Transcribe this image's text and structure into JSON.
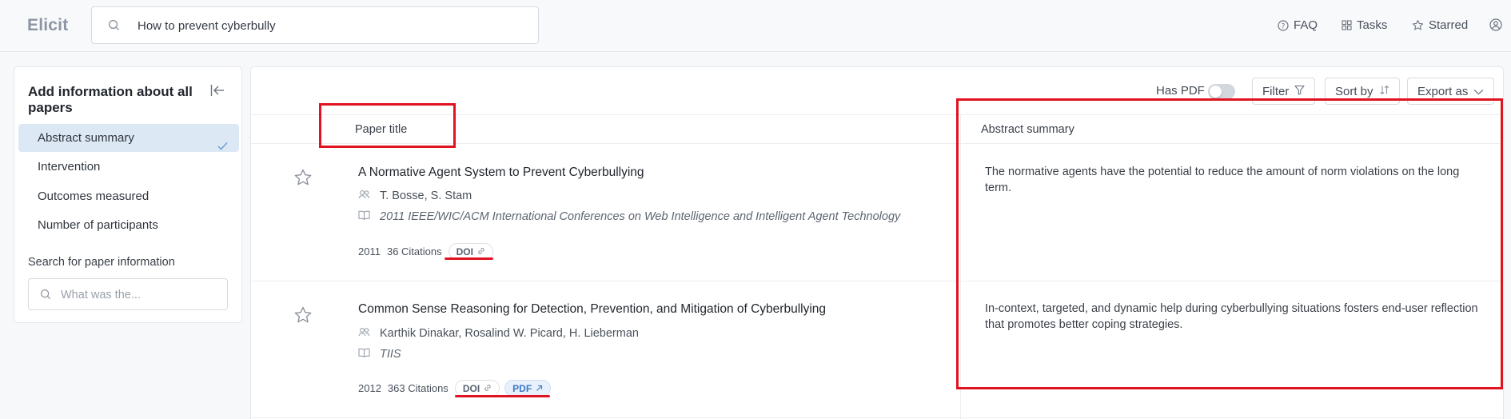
{
  "app": {
    "name": "Elicit"
  },
  "search": {
    "query": "How to prevent cyberbully"
  },
  "nav": {
    "faq": "FAQ",
    "tasks": "Tasks",
    "starred": "Starred"
  },
  "sidebar": {
    "title": "Add information about all papers",
    "items": [
      {
        "label": "Abstract summary",
        "active": true
      },
      {
        "label": "Intervention",
        "active": false
      },
      {
        "label": "Outcomes measured",
        "active": false
      },
      {
        "label": "Number of participants",
        "active": false
      }
    ],
    "search_label": "Search for paper information",
    "search_placeholder": "What was the..."
  },
  "toolbar": {
    "has_pdf_label": "Has PDF",
    "has_pdf_on": false,
    "filter_label": "Filter",
    "sort_label": "Sort by",
    "export_label": "Export as"
  },
  "columns": {
    "title": "Paper title",
    "abstract": "Abstract summary"
  },
  "papers": [
    {
      "title": "A Normative Agent System to Prevent Cyberbullying",
      "authors": "T. Bosse, S. Stam",
      "venue": "2011 IEEE/WIC/ACM International Conferences on Web Intelligence and Intelligent Agent Technology",
      "year": "2011",
      "citations": "36 Citations",
      "doi_label": "DOI",
      "abstract": "The normative agents have the potential to reduce the amount of norm violations on the long term."
    },
    {
      "title": "Common Sense Reasoning for Detection, Prevention, and Mitigation of Cyberbullying",
      "authors": "Karthik Dinakar, Rosalind W. Picard, H. Lieberman",
      "venue": "TIIS",
      "year": "2012",
      "citations": "363 Citations",
      "doi_label": "DOI",
      "pdf_label": "PDF",
      "abstract": "In-context, targeted, and dynamic help during cyberbullying situations fosters end-user reflection that promotes better coping strategies."
    }
  ],
  "colors": {
    "accent": "#3a78c8",
    "active_item_bg": "#dde8f5",
    "annotation_red": "#e01420"
  }
}
